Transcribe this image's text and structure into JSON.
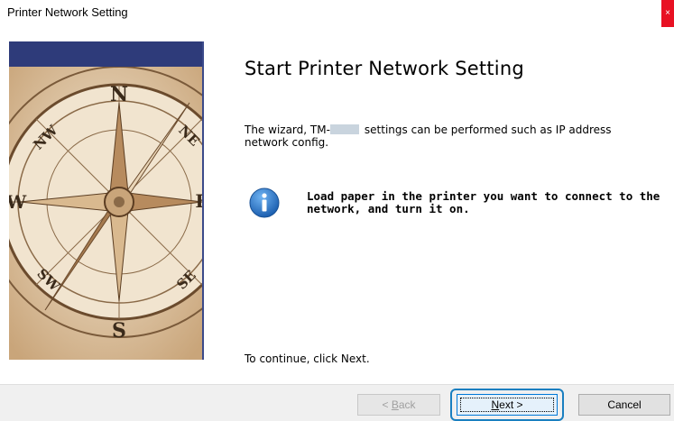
{
  "window": {
    "title": "Printer Network Setting",
    "close_glyph": "×"
  },
  "main": {
    "heading": "Start Printer Network Setting",
    "description_prefix": "The wizard, TM-",
    "description_suffix": "settings can be performed such as IP address network config.",
    "info_message": "Load paper in the printer you want to connect to the network, and turn it on.",
    "continue_text": "To continue, click Next."
  },
  "compass": {
    "directions": [
      "N",
      "NE",
      "E",
      "SE",
      "S",
      "SW",
      "W",
      "NW"
    ]
  },
  "buttons": {
    "back_label_mnemonic": "B",
    "back_label_rest": "ack",
    "back_prefix": "< ",
    "next_label_mnemonic": "N",
    "next_label_rest": "ext >",
    "cancel_label": "Cancel"
  },
  "colors": {
    "accent": "#0078d7",
    "focus_ring": "#1a7fc0",
    "banner": "#2e3b7a",
    "close": "#e81123"
  },
  "icons": {
    "info": "info-icon",
    "compass": "compass-image"
  }
}
